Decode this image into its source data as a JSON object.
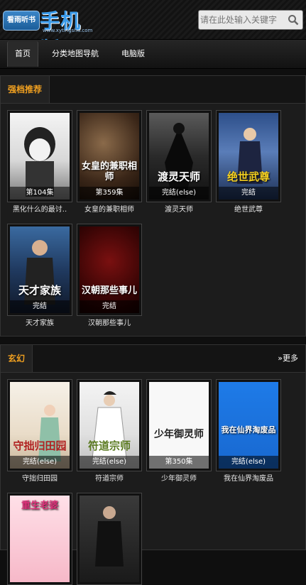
{
  "header": {
    "logo_badge": "看雨听书",
    "logo_text": "手机版",
    "logo_url": "www.xytingshu.com",
    "search_placeholder": "请在此处输入关键字",
    "search_icon": "search-icon"
  },
  "nav": {
    "items": [
      "首页",
      "分类地图导航",
      "电脑版"
    ]
  },
  "section1": {
    "title": "强档推荐",
    "books": [
      {
        "name": "黑化什么的最讨..",
        "badge": "第104集",
        "cover_title": ""
      },
      {
        "name": "女皇的兼职相师",
        "badge": "第359集",
        "cover_title": "女皇的兼职相师"
      },
      {
        "name": "渡灵天师",
        "badge": "完结(else)",
        "cover_title": "渡灵天师"
      },
      {
        "name": "绝世武尊",
        "badge": "完结",
        "cover_title": "绝世武尊"
      },
      {
        "name": "天才家族",
        "badge": "完结",
        "cover_title": "天才家族"
      },
      {
        "name": "汉朝那些事儿",
        "badge": "完结",
        "cover_title": "汉朝那些事儿"
      }
    ]
  },
  "section2": {
    "title": "玄幻",
    "more": "»更多",
    "books": [
      {
        "name": "守拙归田园",
        "badge": "完结(else)",
        "cover_title": "守拙归田园"
      },
      {
        "name": "符道宗师",
        "badge": "完结(else)",
        "cover_title": "符道宗师"
      },
      {
        "name": "少年御灵师",
        "badge": "第350集",
        "cover_title": "少年御灵师"
      },
      {
        "name": "我在仙界淘废品",
        "badge": "完结(else)",
        "cover_title": "我在仙界淘废品"
      },
      {
        "name": "",
        "badge": "",
        "cover_title": "重生老婆"
      },
      {
        "name": "",
        "badge": "",
        "cover_title": ""
      }
    ]
  },
  "colors": {
    "accent": "#f0a020",
    "brand_blue": "#3b9bea"
  }
}
